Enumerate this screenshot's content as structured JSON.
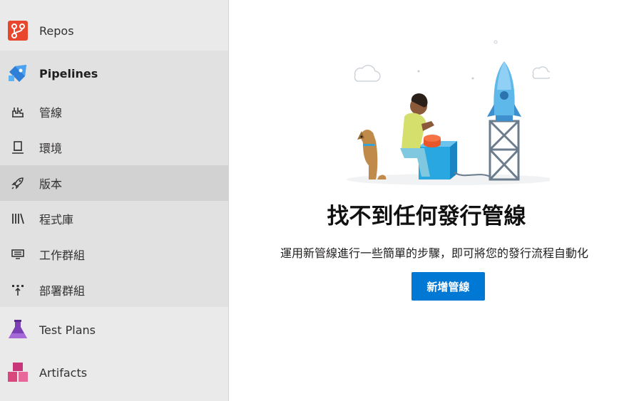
{
  "sidebar": {
    "repos": {
      "label": "Repos",
      "icon": "repos-icon"
    },
    "pipelines": {
      "label": "Pipelines",
      "icon": "pipelines-icon",
      "items": [
        {
          "label": "管線",
          "icon": "pipeline-icon"
        },
        {
          "label": "環境",
          "icon": "environment-icon"
        },
        {
          "label": "版本",
          "icon": "rocket-icon",
          "selected": true
        },
        {
          "label": "程式庫",
          "icon": "library-icon"
        },
        {
          "label": "工作群組",
          "icon": "task-group-icon"
        },
        {
          "label": "部署群組",
          "icon": "deployment-group-icon"
        }
      ]
    },
    "test_plans": {
      "label": "Test Plans",
      "icon": "test-plans-icon"
    },
    "artifacts": {
      "label": "Artifacts",
      "icon": "artifacts-icon"
    }
  },
  "main": {
    "title": "找不到任何發行管線",
    "description": "運用新管線進行一些簡單的步驟，即可將您的發行流程自動化",
    "button_label": "新增管線"
  },
  "colors": {
    "accent": "#0078d4",
    "sidebar_bg": "#eaeaea",
    "selected_bg": "#d2d2d2"
  }
}
